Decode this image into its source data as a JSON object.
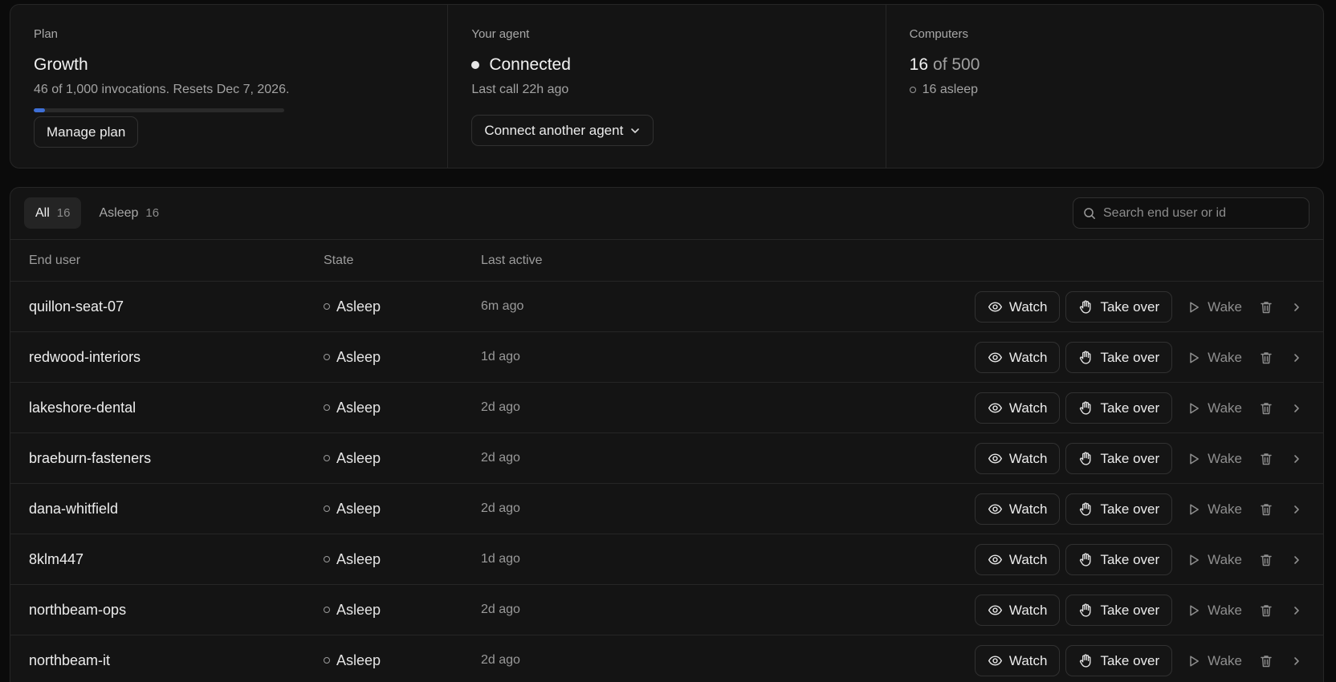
{
  "summary": {
    "plan": {
      "label": "Plan",
      "name": "Growth",
      "usage": "46 of 1,000 invocations. Resets Dec 7, 2026.",
      "usage_fraction": 0.046,
      "button": "Manage plan"
    },
    "agent": {
      "label": "Your agent",
      "status": "Connected",
      "last_call": "Last call 22h ago",
      "button": "Connect another agent"
    },
    "computers": {
      "label": "Computers",
      "count": "16",
      "of_total": "of 500",
      "asleep": "16 asleep"
    }
  },
  "tabs": [
    {
      "label": "All",
      "count": "16"
    },
    {
      "label": "Asleep",
      "count": "16"
    }
  ],
  "search": {
    "placeholder": "Search end user or id"
  },
  "columns": {
    "user": "End user",
    "state": "State",
    "active": "Last active"
  },
  "actions": {
    "watch": "Watch",
    "takeover": "Take over",
    "wake": "Wake"
  },
  "rows": [
    {
      "user": "quillon-seat-07",
      "state": "Asleep",
      "active": "6m ago"
    },
    {
      "user": "redwood-interiors",
      "state": "Asleep",
      "active": "1d ago"
    },
    {
      "user": "lakeshore-dental",
      "state": "Asleep",
      "active": "2d ago"
    },
    {
      "user": "braeburn-fasteners",
      "state": "Asleep",
      "active": "2d ago"
    },
    {
      "user": "dana-whitfield",
      "state": "Asleep",
      "active": "2d ago"
    },
    {
      "user": "8klm447",
      "state": "Asleep",
      "active": "1d ago"
    },
    {
      "user": "northbeam-ops",
      "state": "Asleep",
      "active": "2d ago"
    },
    {
      "user": "northbeam-it",
      "state": "Asleep",
      "active": "2d ago"
    }
  ],
  "icons": {
    "status_dot": "status-dot-icon",
    "watch": "eye-icon",
    "takeover": "hand-icon",
    "wake": "play-icon",
    "delete": "trash-icon",
    "open": "chevron-right-icon",
    "search": "search-icon",
    "dropdown": "chevron-down-icon"
  },
  "colors": {
    "background": "#0b0b0b",
    "panel": "#141414",
    "accent": "#3e6fd6"
  }
}
